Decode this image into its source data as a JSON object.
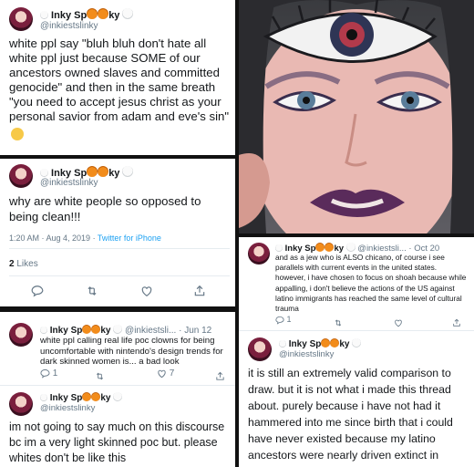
{
  "tweets": {
    "t1": {
      "name": "Inky Sp  ky",
      "handle": "@inkiestslinky",
      "text": "white ppl say \"bluh bluh don't hate all white ppl just because SOME of our ancestors owned slaves and committed genocide\" and then in the same breath \"you need to accept jesus christ as your personal savior from adam and eve's sin\""
    },
    "t2": {
      "name": "Inky Sp  ky",
      "handle": "@inkiestslinky",
      "text": "why are white people so opposed to being clean!!!",
      "time": "1:20 AM · Aug 4, 2019 · ",
      "client": "Twitter for iPhone",
      "likes_count": "2",
      "likes_label": "Likes"
    },
    "t3": {
      "name": "Inky Sp  ky",
      "handle": "@inkiestsli...",
      "date": "· Oct 20",
      "text": "and as a jew who is ALSO chicano, of course i see parallels with current events in the united states. however, i have chosen to focus on shoah because while appalling, i don't believe the actions of the US against latino immigrants has reached the same level of cultural trauma",
      "replies": "1"
    },
    "t4": {
      "name": "Inky Sp  ky",
      "handle": "@inkiestslinky",
      "text": "it is still an extremely valid comparison to draw. but it is not what i made this thread about. purely because i have not had it hammered into me since birth that i could have never existed because my latino ancestors were nearly driven extinct in living memory"
    },
    "t5": {
      "name": "Inky Sp  ky",
      "handle": "@inkiestsli...",
      "date": "· Jun 12",
      "text": "white ppl calling real life poc clowns for being uncomfortable with nintendo's design trends for dark skinned women is... a bad look",
      "replies": "1",
      "likes": "7"
    },
    "t6": {
      "name": "Inky Sp  ky",
      "handle": "@inkiestslinky",
      "text": "im not going to say much on this discourse bc im a very light skinned poc but. please whites don't be like this"
    }
  },
  "colors": {
    "link": "#1da1f2",
    "meta": "#657786",
    "text": "#14171a"
  },
  "icons": [
    "reply-icon",
    "retweet-icon",
    "like-icon",
    "share-icon",
    "pumpkin-emoji",
    "skull-emoji",
    "thinking-emoji"
  ]
}
